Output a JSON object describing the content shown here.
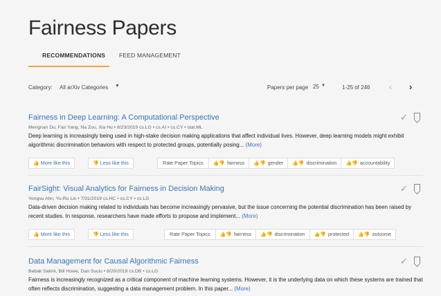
{
  "page": {
    "title": "Fairness Papers"
  },
  "tabs": [
    {
      "label": "RECOMMENDATIONS",
      "active": true
    },
    {
      "label": "FEED MANAGEMENT",
      "active": false
    }
  ],
  "toolbar": {
    "category_label": "Category:",
    "category_value": "All arXiv Categories",
    "per_page_label": "Papers per page",
    "per_page_value": "25",
    "range": "1-25 of 246"
  },
  "actions": {
    "more_like": "More like this",
    "less_like": "Less like this",
    "rate_topics": "Rate Paper Topics"
  },
  "papers": [
    {
      "title": "Fairness in Deep Learning: A Computational Perspective",
      "meta": "Mengnan Du, Fan Yang, Na Zou, Xia Hu  •  8/23/2019   cs.LG • cs.AI • cs.CY • stat.ML",
      "abstract": "Deep learning is increasingly being used in high-stake decision making applications that affect individual lives. However, deep learning models might exhibit algorithmic discrimination behaviors with respect to protected groups, potentially posing...",
      "more": "(More)",
      "topics": [
        "fairness",
        "gender",
        "discrimination",
        "accountability"
      ]
    },
    {
      "title": "FairSight: Visual Analytics for Fairness in Decision Making",
      "meta": "Yongsu Ahn, Yu-Ru Lin  •  7/31/2019   cs.HC • cs.CY • cs.LG",
      "abstract": "Data-driven decision making related to individuals has become increasingly pervasive, but the issue concerning the potential discrimination has been raised by recent studies. In response, researchers have made efforts to propose and implement...",
      "more": "(More)",
      "topics": [
        "fairness",
        "discrimination",
        "protected",
        "outcome"
      ]
    },
    {
      "title": "Data Management for Causal Algorithmic Fairness",
      "meta": "Babak Salimi, Bill Howe, Dan Suciu  •  8/20/2019   cs.DB • cs.LG",
      "abstract": "Fairness is increasingly recognized as a critical component of machine learning systems. However, it is the underlying data on which these systems are trained that often reflects discrimination, suggesting a data management problem. In this paper...",
      "more": "(More)",
      "topics": []
    }
  ]
}
